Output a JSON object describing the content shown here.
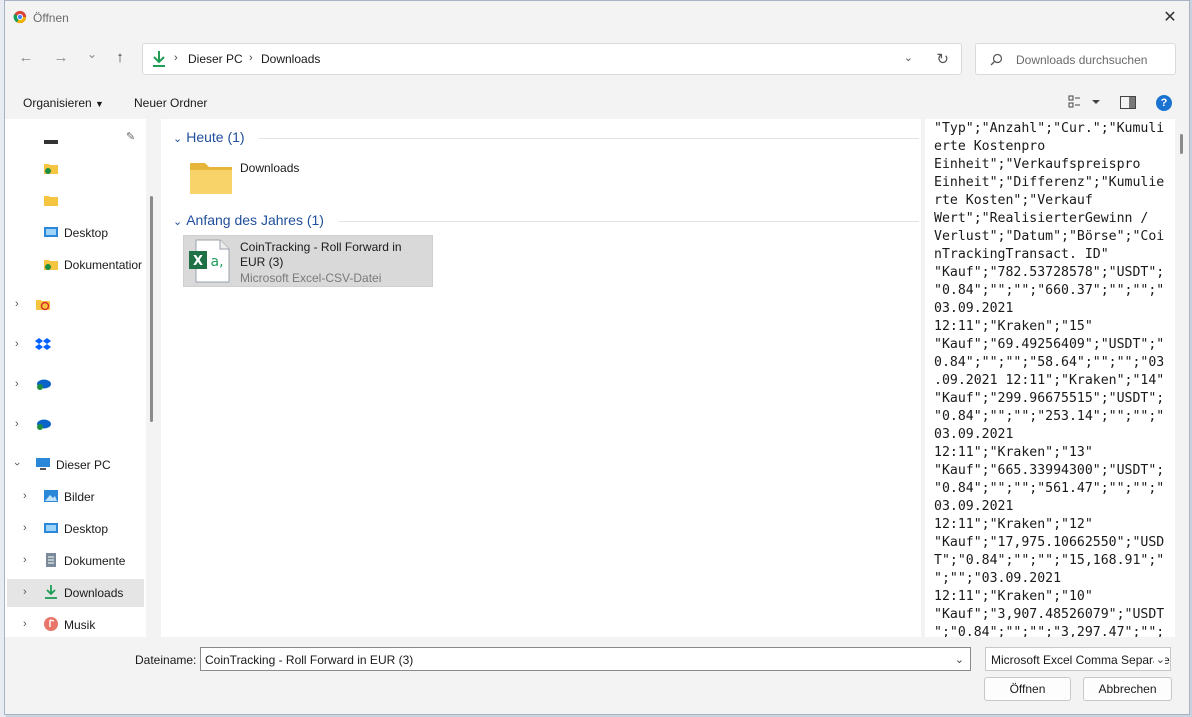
{
  "window": {
    "title": "Öffnen",
    "close": "✕"
  },
  "nav": {
    "back": "←",
    "forward": "→",
    "recent": "⌄",
    "up": "↑"
  },
  "address": {
    "crumbs": [
      "Dieser PC",
      "Downloads"
    ],
    "separator": "›"
  },
  "search": {
    "placeholder": "Downloads durchsuchen"
  },
  "toolbar": {
    "organize": "Organisieren",
    "new_folder": "Neuer Ordner",
    "help": "?"
  },
  "sidebar": {
    "items": [
      {
        "label": "Desktop"
      },
      {
        "label": "Dokumentatior"
      },
      {
        "label": "Dieser PC"
      },
      {
        "label": "Bilder"
      },
      {
        "label": "Desktop"
      },
      {
        "label": "Dokumente"
      },
      {
        "label": "Downloads"
      },
      {
        "label": "Musik"
      }
    ]
  },
  "groups": [
    {
      "title": "Heute (1)",
      "files": [
        {
          "name": "Downloads",
          "type": ""
        }
      ]
    },
    {
      "title": "Anfang des Jahres (1)",
      "files": [
        {
          "name": "CoinTracking - Roll Forward in EUR (3)",
          "type": "Microsoft Excel-CSV-Datei"
        }
      ]
    }
  ],
  "preview": {
    "text": "\"Typ\";\"Anzahl\";\"Cur.\";\"Kumuli\nerte Kostenpro\nEinheit\";\"Verkaufspreispro\nEinheit\";\"Differenz\";\"Kumulie\nrte Kosten\";\"Verkauf\nWert\";\"RealisierterGewinn /\nVerlust\";\"Datum\";\"Börse\";\"Coi\nnTrackingTransact. ID\"\n\"Kauf\";\"782.53728578\";\"USDT\";\n\"0.84\";\"\";\"\";\"660.37\";\"\";\"\";\"\n03.09.2021\n12:11\";\"Kraken\";\"15\"\n\"Kauf\";\"69.49256409\";\"USDT\";\"\n0.84\";\"\";\"\";\"58.64\";\"\";\"\";\"03\n.09.2021 12:11\";\"Kraken\";\"14\"\n\"Kauf\";\"299.96675515\";\"USDT\";\n\"0.84\";\"\";\"\";\"253.14\";\"\";\"\";\"\n03.09.2021\n12:11\";\"Kraken\";\"13\"\n\"Kauf\";\"665.33994300\";\"USDT\";\n\"0.84\";\"\";\"\";\"561.47\";\"\";\"\";\"\n03.09.2021\n12:11\";\"Kraken\";\"12\"\n\"Kauf\";\"17,975.10662550\";\"USD\nT\";\"0.84\";\"\";\"\";\"15,168.91\";\"\n\";\"\";\"03.09.2021\n12:11\";\"Kraken\";\"10\"\n\"Kauf\";\"3,907.48526079\";\"USDT\n\";\"0.84\";\"\";\"\";\"3,297.47\";\"\";"
  },
  "footer": {
    "filename_label": "Dateiname:",
    "filename_value": "CoinTracking - Roll Forward in EUR (3)",
    "filetype_value": "Microsoft Excel Comma Separated Values File",
    "open": "Öffnen",
    "cancel": "Abbrechen"
  },
  "colors": {
    "accent": "#1a73d1",
    "group_title": "#1f4e9c",
    "excel_green": "#1e7145",
    "folder": "#f5c542"
  }
}
